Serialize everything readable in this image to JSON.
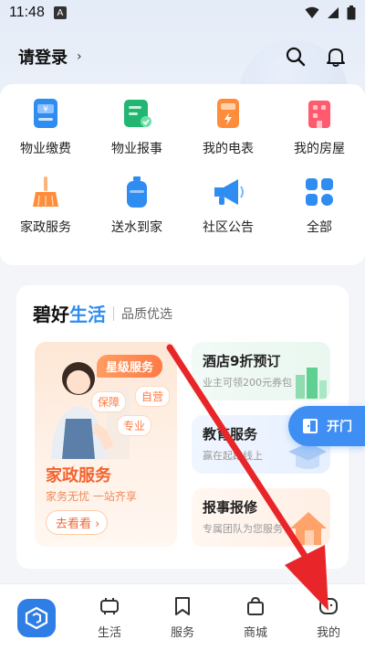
{
  "status_bar": {
    "time": "11:48",
    "notif_badge": "A"
  },
  "header": {
    "login_label": "请登录",
    "chevron": "›"
  },
  "services": [
    {
      "label": "物业缴费",
      "icon": "property-fee-icon",
      "color": "#2f8cf0"
    },
    {
      "label": "物业报事",
      "icon": "property-report-icon",
      "color": "#22b673"
    },
    {
      "label": "我的电表",
      "icon": "electric-meter-icon",
      "color": "#ff8c3a"
    },
    {
      "label": "我的房屋",
      "icon": "my-house-icon",
      "color": "#ff5a6e"
    },
    {
      "label": "家政服务",
      "icon": "housekeeping-broom-icon",
      "color": "#ff8c3a"
    },
    {
      "label": "送水到家",
      "icon": "water-delivery-icon",
      "color": "#2f8cf0"
    },
    {
      "label": "社区公告",
      "icon": "community-megaphone-icon",
      "color": "#2f8cf0"
    },
    {
      "label": "全部",
      "icon": "all-grid-icon",
      "color": "#2f8cf0"
    }
  ],
  "life": {
    "brand_a": "碧好",
    "brand_b": "生活",
    "subtitle": "品质优选",
    "promo_main": {
      "badge": "星级服务",
      "tags": [
        "保障",
        "自营",
        "专业"
      ],
      "title": "家政服务",
      "subtitle": "家务无忧 一站齐享",
      "button": "去看看"
    },
    "promos": [
      {
        "title": "酒店9折预订",
        "subtitle": "业主可领200元券包"
      },
      {
        "title": "教育服务",
        "subtitle": "赢在起跑线上"
      },
      {
        "title": "报事报修",
        "subtitle": "专属团队为您服务"
      }
    ]
  },
  "open_door": {
    "label": "开门"
  },
  "tabbar": {
    "items": [
      {
        "label": "",
        "icon": "home-logo-icon"
      },
      {
        "label": "生活",
        "icon": "life-icon"
      },
      {
        "label": "服务",
        "icon": "service-bookmark-icon"
      },
      {
        "label": "商城",
        "icon": "shopping-bag-icon"
      },
      {
        "label": "我的",
        "icon": "profile-icon"
      }
    ]
  },
  "colors": {
    "accent": "#2f8cf0",
    "orange": "#f3632f",
    "arrow": "#e8262a"
  }
}
